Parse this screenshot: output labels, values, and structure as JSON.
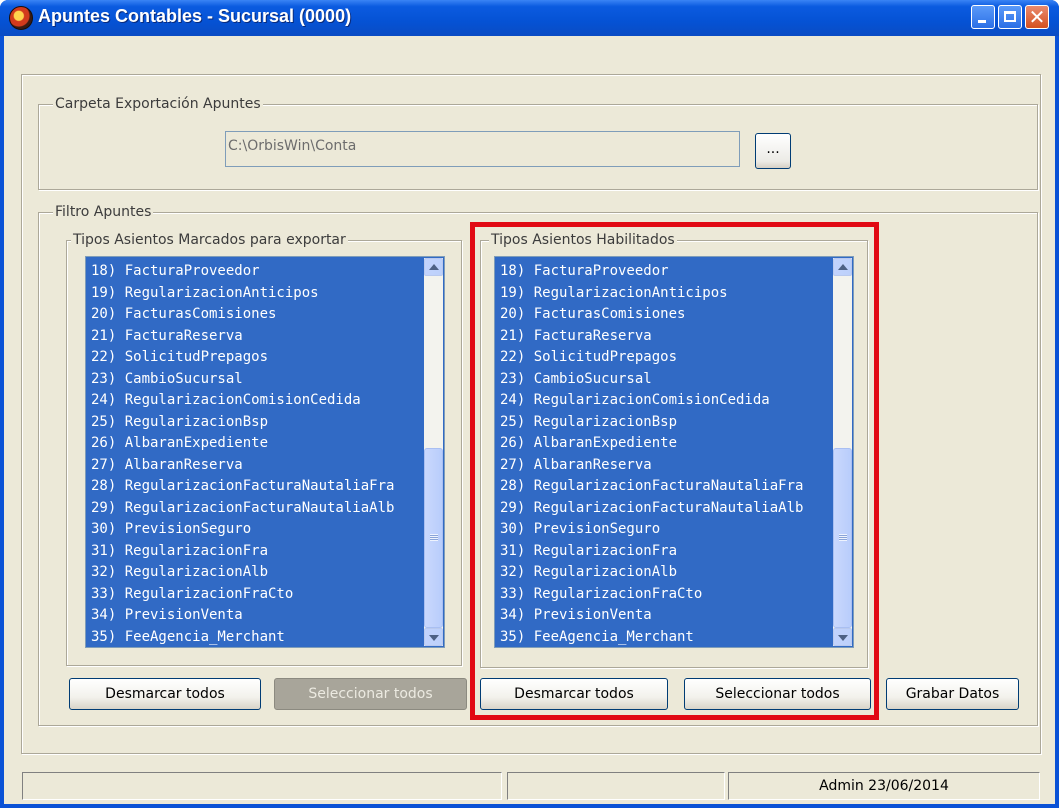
{
  "window": {
    "title": "Apuntes Contables - Sucursal (0000)"
  },
  "export_folder": {
    "label": "Carpeta Exportación Apuntes",
    "path": "C:\\OrbisWin\\Conta",
    "browse_label": "..."
  },
  "filter": {
    "label": "Filtro Apuntes"
  },
  "marked_list": {
    "label": "Tipos Asientos Marcados para exportar",
    "items": [
      "18) FacturaProveedor",
      "19) RegularizacionAnticipos",
      "20) FacturasComisiones",
      "21) FacturaReserva",
      "22) SolicitudPrepagos",
      "23) CambioSucursal",
      "24) RegularizacionComisionCedida",
      "25) RegularizacionBsp",
      "26) AlbaranExpediente",
      "27) AlbaranReserva",
      "28) RegularizacionFacturaNautaliaFra",
      "29) RegularizacionFacturaNautaliaAlb",
      "30) PrevisionSeguro",
      "31) RegularizacionFra",
      "32) RegularizacionAlb",
      "33) RegularizacionFraCto",
      "34) PrevisionVenta",
      "35) FeeAgencia_Merchant"
    ]
  },
  "enabled_list": {
    "label": "Tipos Asientos Habilitados",
    "items": [
      "18) FacturaProveedor",
      "19) RegularizacionAnticipos",
      "20) FacturasComisiones",
      "21) FacturaReserva",
      "22) SolicitudPrepagos",
      "23) CambioSucursal",
      "24) RegularizacionComisionCedida",
      "25) RegularizacionBsp",
      "26) AlbaranExpediente",
      "27) AlbaranReserva",
      "28) RegularizacionFacturaNautaliaFra",
      "29) RegularizacionFacturaNautaliaAlb",
      "30) PrevisionSeguro",
      "31) RegularizacionFra",
      "32) RegularizacionAlb",
      "33) RegularizacionFraCto",
      "34) PrevisionVenta",
      "35) FeeAgencia_Merchant"
    ]
  },
  "buttons": {
    "left_deselect": "Desmarcar todos",
    "left_select": "Seleccionar todos",
    "right_deselect": "Desmarcar todos",
    "right_select": "Seleccionar todos",
    "save": "Grabar Datos"
  },
  "status": {
    "user_date": "Admin 23/06/2014"
  },
  "colors": {
    "selection": "#316ac5",
    "highlight": "#e10a14",
    "face": "#ece9d8"
  }
}
